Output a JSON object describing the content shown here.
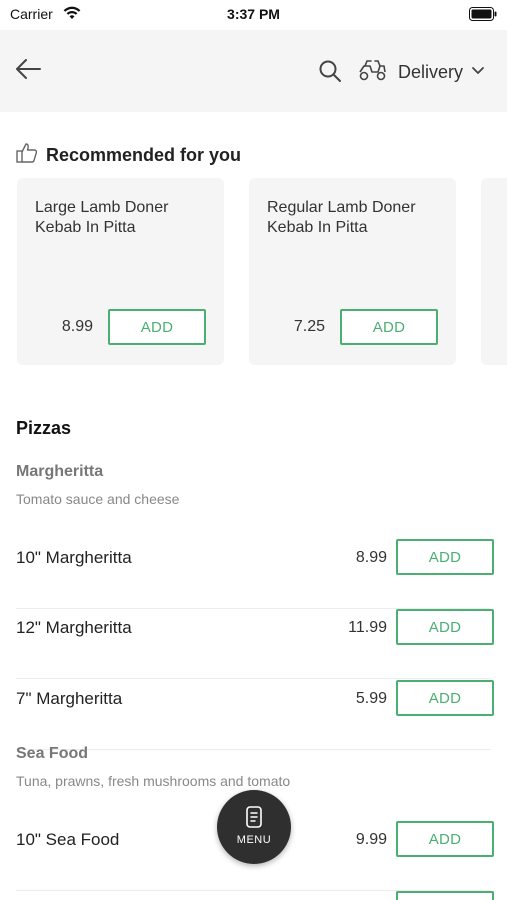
{
  "status_bar": {
    "carrier": "Carrier",
    "time": "3:37 PM"
  },
  "header": {
    "back_icon": "arrow-left-icon",
    "search_icon": "search-icon",
    "delivery_icon": "scooter-icon",
    "delivery_label": "Delivery",
    "dropdown_icon": "chevron-down-icon",
    "background": "#f5f5f5"
  },
  "recommended": {
    "icon": "thumbs-up-icon",
    "title": "Recommended for you",
    "cards": [
      {
        "name": "Large Lamb Doner Kebab In Pitta",
        "price": "8.99",
        "add_label": "ADD"
      },
      {
        "name": "Regular Lamb Doner Kebab In Pitta",
        "price": "7.25",
        "add_label": "ADD"
      }
    ]
  },
  "menu": {
    "section_title": "Pizzas",
    "groups": [
      {
        "title": "Margheritta",
        "description": "Tomato sauce and cheese",
        "items": [
          {
            "name": "10\" Margheritta",
            "price": "8.99",
            "add_label": "ADD"
          },
          {
            "name": "12\" Margheritta",
            "price": "11.99",
            "add_label": "ADD"
          },
          {
            "name": "7\" Margheritta",
            "price": "5.99",
            "add_label": "ADD"
          }
        ]
      },
      {
        "title": "Sea Food",
        "description": "Tuna, prawns, fresh mushrooms and tomato",
        "items": [
          {
            "name": "10\" Sea Food",
            "price": "9.99",
            "add_label": "ADD"
          }
        ]
      }
    ]
  },
  "fab": {
    "icon": "menu-card-icon",
    "label": "MENU"
  },
  "colors": {
    "accent": "#4caf72",
    "fab_background": "#2f2f2f"
  }
}
